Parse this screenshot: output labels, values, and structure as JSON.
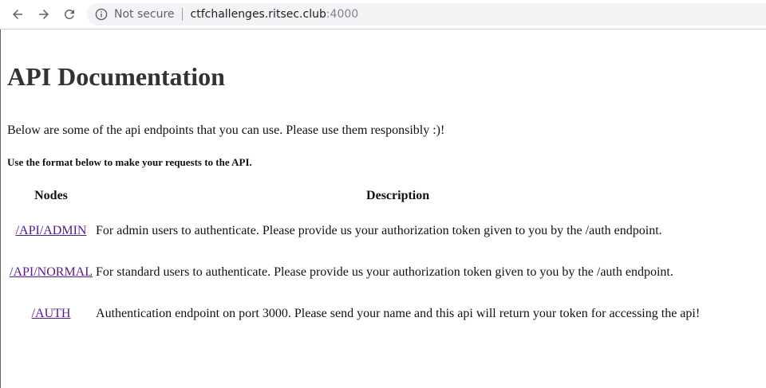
{
  "browser": {
    "security_label": "Not secure",
    "url_host": "ctfchallenges.ritsec.club",
    "url_port": ":4000"
  },
  "page": {
    "title": "API Documentation",
    "intro": "Below are some of the api endpoints that you can use. Please use them responsibly :)!",
    "format_note": "Use the format below to make your requests to the API.",
    "table": {
      "headers": [
        "Nodes",
        "Description"
      ],
      "rows": [
        {
          "node": "/API/ADMIN",
          "description": "For admin users to authenticate. Please provide us your authorization token given to you by the /auth endpoint."
        },
        {
          "node": "/API/NORMAL",
          "description": "For standard users to authenticate. Please provide us your authorization token given to you by the /auth endpoint."
        },
        {
          "node": "/AUTH",
          "description": "Authentication endpoint on port 3000. Please send your name and this api will return your token for accessing the api!"
        }
      ]
    }
  },
  "colors": {
    "link_visited": "#551a8b",
    "omnibox_bg": "#f1f3f4"
  }
}
